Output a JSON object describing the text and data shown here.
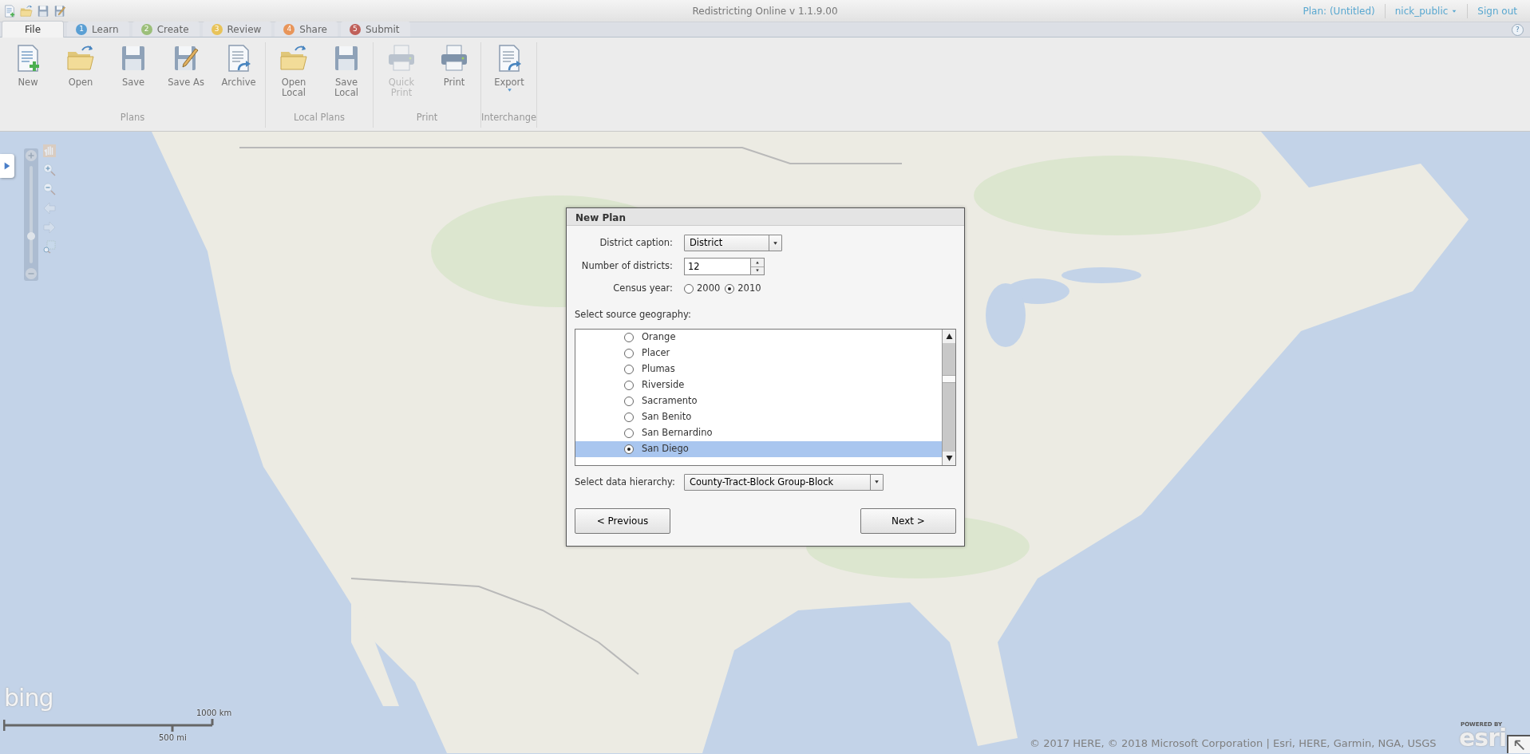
{
  "window": {
    "title": "Redistricting Online  v 1.1.9.00"
  },
  "header_links": [
    {
      "label": "Plan: (Untitled)",
      "kind": "text"
    },
    {
      "label": "nick_public",
      "kind": "menu"
    },
    {
      "label": "Sign out",
      "kind": "link"
    }
  ],
  "tabs": [
    {
      "label": "File",
      "selected": true
    },
    {
      "number": "1",
      "label": "Learn",
      "color": "#5a9fd4",
      "selected": false
    },
    {
      "number": "2",
      "label": "Create",
      "color": "#9cbf7a",
      "selected": false
    },
    {
      "number": "3",
      "label": "Review",
      "color": "#e8c35a",
      "selected": false
    },
    {
      "number": "4",
      "label": "Share",
      "color": "#e8955a",
      "selected": false
    },
    {
      "number": "5",
      "label": "Submit",
      "color": "#c0605a",
      "selected": false
    }
  ],
  "help": "?",
  "ribbon_groups": [
    {
      "label": "Plans",
      "buttons": [
        {
          "label": "New",
          "disabled": false
        },
        {
          "label": "Open",
          "disabled": false
        },
        {
          "label": "Save",
          "disabled": false
        },
        {
          "label": "Save As",
          "disabled": false
        },
        {
          "label": "Archive",
          "disabled": false
        }
      ]
    },
    {
      "label": "Local Plans",
      "buttons": [
        {
          "label": "Open Local",
          "disabled": false
        },
        {
          "label": "Save Local",
          "disabled": false
        }
      ]
    },
    {
      "label": "Print",
      "buttons": [
        {
          "label": "Quick Print",
          "disabled": true
        },
        {
          "label": "Print",
          "disabled": false
        }
      ]
    },
    {
      "label": "Interchange",
      "buttons": [
        {
          "label": "Export",
          "disabled": false,
          "kind": "dropdown"
        }
      ]
    }
  ],
  "map": {
    "kind": "picture",
    "zoom_slider": {
      "level": 0.28
    },
    "scale": {
      "km": "1000 km",
      "mi": "500 mi"
    },
    "bing": "bing",
    "esri_caption": "POWERED BY",
    "esri": "esri",
    "attribution": "© 2017 HERE, © 2018 Microsoft Corporation | Esri, HERE, Garmin, NGA, USGS"
  },
  "dialog": {
    "title": "New Plan",
    "district_caption": {
      "label": "District caption:",
      "value": "District"
    },
    "num_districts": {
      "label": "Number of districts:",
      "value": "12"
    },
    "census_year": {
      "label": "Census year:",
      "options": [
        {
          "label": "2000",
          "selected": false
        },
        {
          "label": "2010",
          "selected": true
        }
      ]
    },
    "geography": {
      "label": "Select source geography:",
      "items": [
        {
          "label": "Orange",
          "selected": false
        },
        {
          "label": "Placer",
          "selected": false
        },
        {
          "label": "Plumas",
          "selected": false
        },
        {
          "label": "Riverside",
          "selected": false
        },
        {
          "label": "Sacramento",
          "selected": false
        },
        {
          "label": "San Benito",
          "selected": false
        },
        {
          "label": "San Bernardino",
          "selected": false
        },
        {
          "label": "San Diego",
          "selected": true
        }
      ]
    },
    "hierarchy": {
      "label": "Select data hierarchy:",
      "value": "County-Tract-Block Group-Block"
    },
    "buttons": [
      {
        "label": "< Previous"
      },
      {
        "label": "Next >"
      }
    ]
  }
}
